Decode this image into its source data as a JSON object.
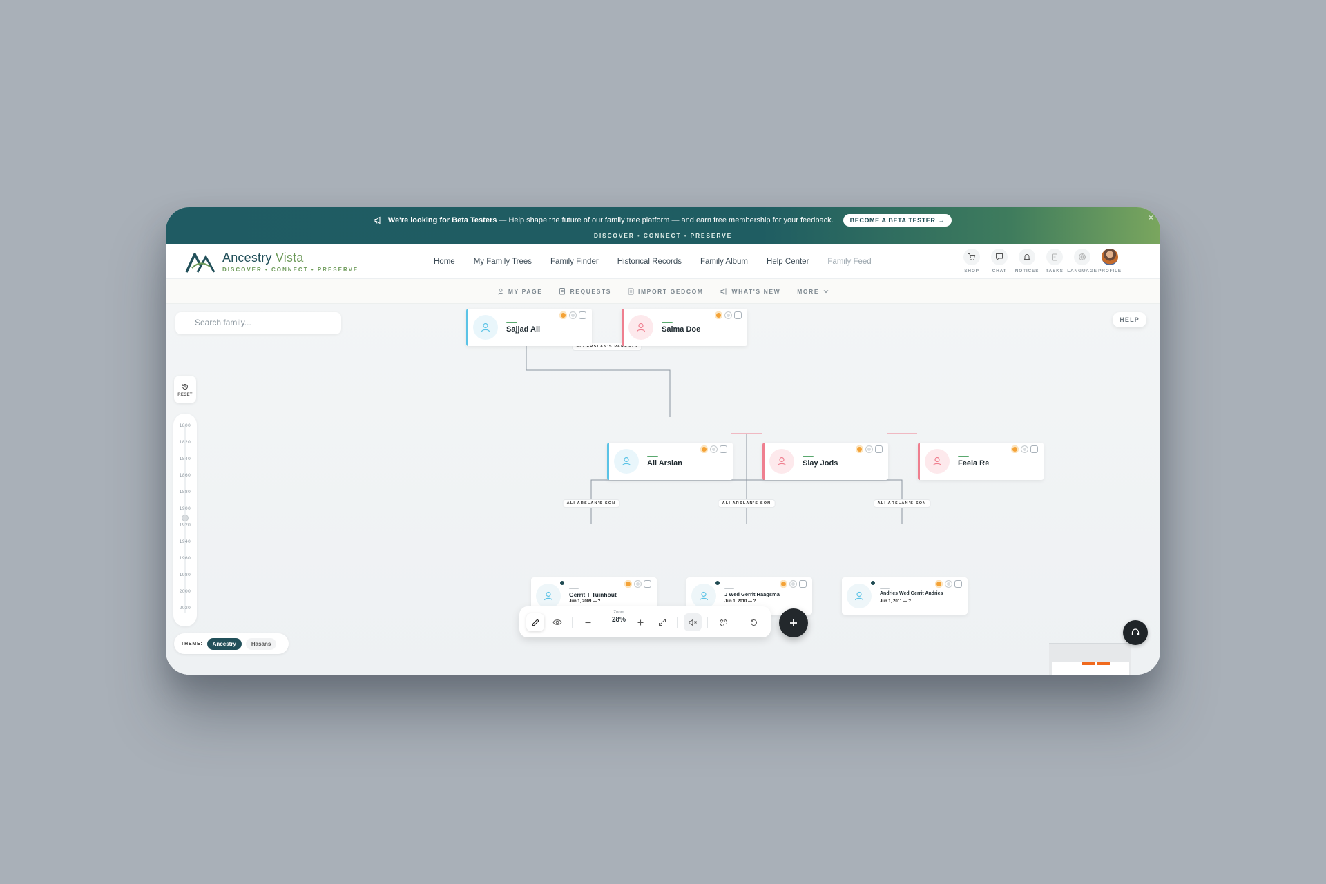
{
  "banner": {
    "lead": "We're looking for Beta Testers",
    "text": " — Help shape the future of our family tree platform — and earn free membership for your feedback.",
    "cta": "BECOME A BETA TESTER",
    "cta_arrow": "→",
    "close": "×",
    "subline": "DISCOVER • CONNECT • PRESERVE"
  },
  "brand": {
    "name_a": "Ancestry",
    "name_b": "Vista",
    "tagline": "DISCOVER • CONNECT • PRESERVE"
  },
  "nav": {
    "links": [
      "Home",
      "My Family Trees",
      "Family Finder",
      "Historical Records",
      "Family Album",
      "Help Center",
      "Family Feed"
    ],
    "icons": [
      {
        "label": "SHOP",
        "icon": "cart-icon"
      },
      {
        "label": "CHAT",
        "icon": "chat-icon"
      },
      {
        "label": "NOTICES",
        "icon": "bell-icon"
      },
      {
        "label": "TASKS",
        "icon": "clipboard-icon"
      },
      {
        "label": "LANGUAGE",
        "icon": "globe-icon"
      },
      {
        "label": "PROFILE",
        "icon": "avatar"
      }
    ]
  },
  "subnav": {
    "items": [
      "MY PAGE",
      "REQUESTS",
      "IMPORT GEDCOM",
      "WHAT'S NEW",
      "MORE"
    ]
  },
  "canvas": {
    "search_placeholder": "Search family...",
    "help": "HELP",
    "reset": "RESET",
    "timeline_years": [
      "1800",
      "1820",
      "1840",
      "1860",
      "1880",
      "1900",
      "1920",
      "1940",
      "1960",
      "1980",
      "2000",
      "2020"
    ],
    "theme_label": "THEME:",
    "themes": [
      "Ancestry",
      "Hasans"
    ],
    "active_theme": "Ancestry"
  },
  "tree": {
    "edge_labels": {
      "parents": "ALI ARSLAN'S PARENTS",
      "son1": "ALI ARSLAN'S SON",
      "son2": "ALI ARSLAN'S SON",
      "son3": "ALI ARSLAN'S SON"
    },
    "people": {
      "sajjad": {
        "name": "Sajjad Ali",
        "gender": "male"
      },
      "salma": {
        "name": "Salma Doe",
        "gender": "female"
      },
      "ali": {
        "name": "Ali Arslan",
        "gender": "male"
      },
      "slay": {
        "name": "Slay Jods",
        "gender": "female"
      },
      "feela": {
        "name": "Feela Re",
        "gender": "female"
      },
      "gerrit": {
        "name": "Gerrit T Tuinhout",
        "date": "Jun 1, 2009 — ?"
      },
      "jwed": {
        "name": "J Wed Gerrit Haagsma",
        "date": "Jun 1, 2010 — ?"
      },
      "andries": {
        "name": "Andries Wed Gerrit Andries",
        "date": "Jun 1, 2011 — ?"
      }
    }
  },
  "toolbar": {
    "zoom_label": "Zoom",
    "zoom_value": "28%"
  },
  "colors": {
    "brand": "#22505a",
    "accent_green": "#6d9a59",
    "male": "#5bc3e6",
    "female": "#ef7f8f",
    "badge_orange": "#f4a236"
  }
}
